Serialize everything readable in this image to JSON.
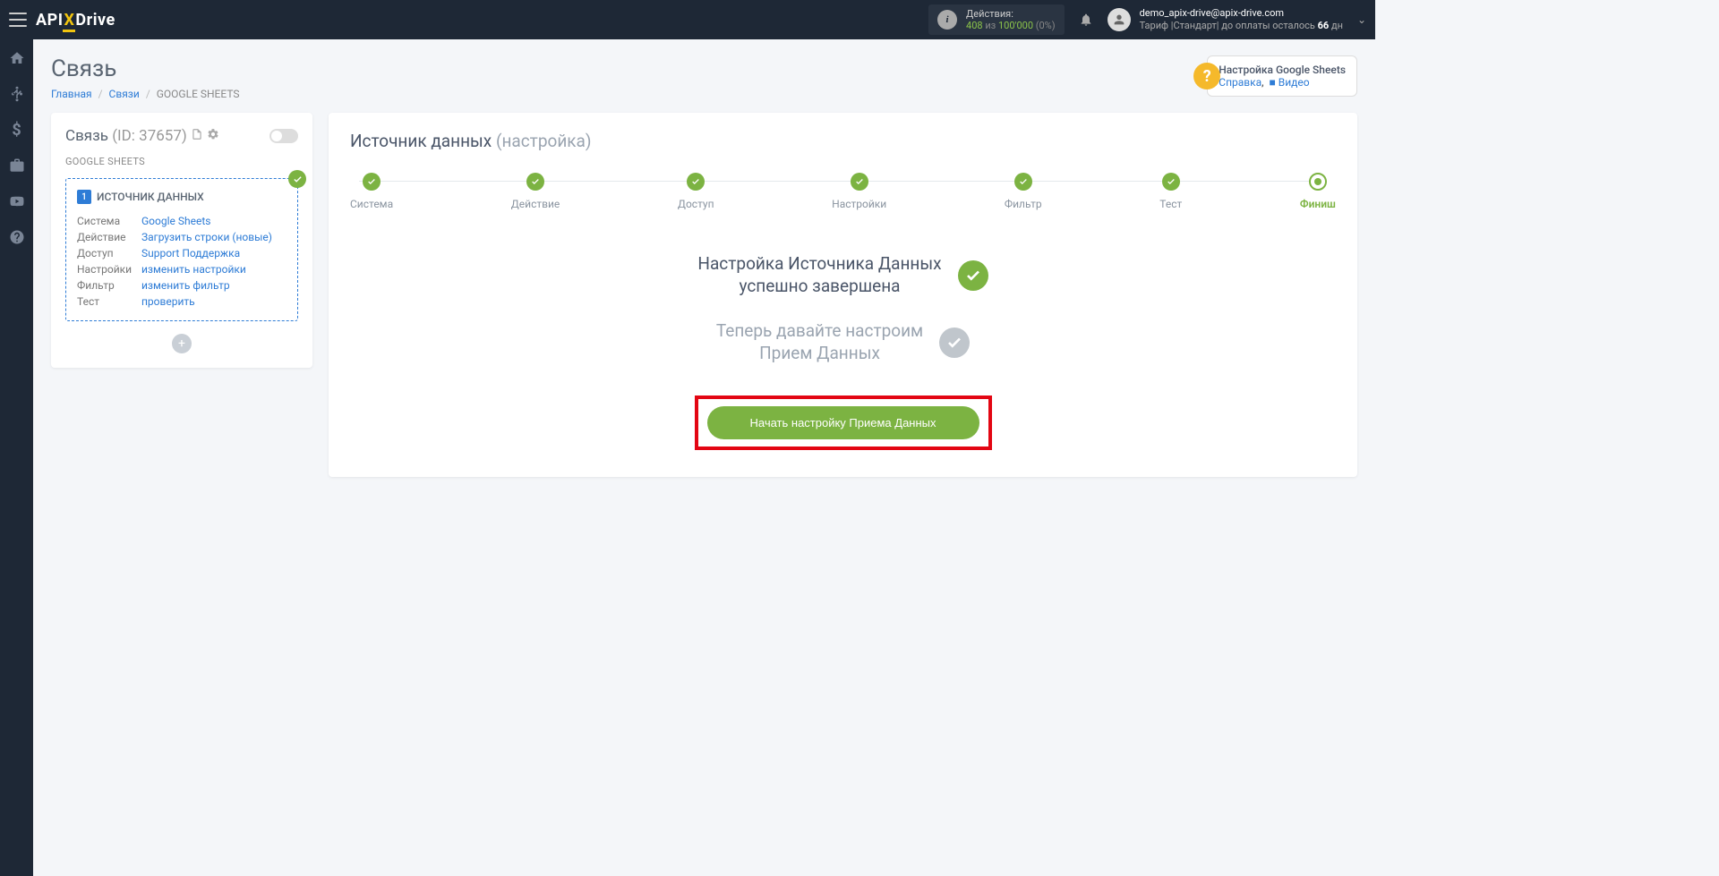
{
  "header": {
    "logo_prefix": "API",
    "logo_x": "X",
    "logo_suffix": "Drive",
    "actions_label": "Действия:",
    "actions_used": "408",
    "actions_of": "из",
    "actions_total": "100'000",
    "actions_pct": "(0%)",
    "user_email": "demo_apix-drive@apix-drive.com",
    "plan_prefix": "Тариф |Стандарт| до оплаты осталось ",
    "plan_days": "66",
    "plan_suffix": " дн"
  },
  "page": {
    "title": "Связь",
    "crumb_home": "Главная",
    "crumb_links": "Связи",
    "crumb_current": "GOOGLE SHEETS"
  },
  "help": {
    "title": "Настройка Google Sheets",
    "link1": "Справка",
    "link2": "Видео"
  },
  "side": {
    "title": "Связь",
    "id_label": "(ID: 37657)",
    "subtitle": "GOOGLE SHEETS",
    "source_num": "1",
    "source_title": "ИСТОЧНИК ДАННЫХ",
    "rows": [
      {
        "k": "Система",
        "v": "Google Sheets"
      },
      {
        "k": "Действие",
        "v": "Загрузить строки (новые)"
      },
      {
        "k": "Доступ",
        "v": "Support Поддержка"
      },
      {
        "k": "Настройки",
        "v": "изменить настройки"
      },
      {
        "k": "Фильтр",
        "v": "изменить фильтр"
      },
      {
        "k": "Тест",
        "v": "проверить"
      }
    ]
  },
  "main": {
    "title_a": "Источник данных",
    "title_b": "(настройка)",
    "steps": [
      "Система",
      "Действие",
      "Доступ",
      "Настройки",
      "Фильтр",
      "Тест",
      "Финиш"
    ],
    "status1_l1": "Настройка Источника Данных",
    "status1_l2": "успешно завершена",
    "status2_l1": "Теперь давайте настроим",
    "status2_l2": "Прием Данных",
    "button": "Начать настройку Приема Данных"
  }
}
